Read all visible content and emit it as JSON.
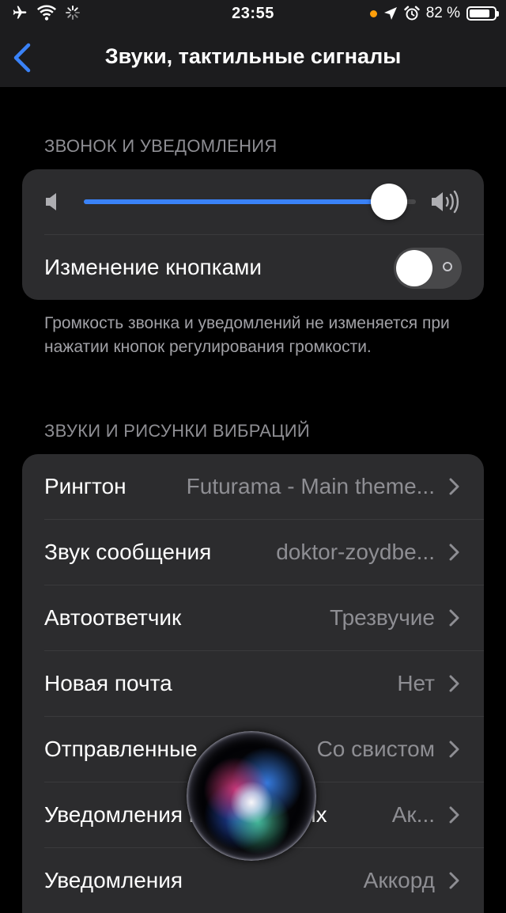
{
  "status_bar": {
    "time": "23:55",
    "battery_percent": "82 %",
    "battery_level": 0.82,
    "left_icons": [
      "airplane-icon",
      "wifi-icon",
      "activity-spinner-icon"
    ],
    "right_icons": [
      "privacy-dot-icon",
      "location-arrow-icon",
      "alarm-icon",
      "battery-icon"
    ]
  },
  "nav": {
    "title": "Звуки, тактильные сигналы",
    "back_icon": "chevron-left-icon"
  },
  "colors": {
    "accent": "#3a82f7",
    "background": "#000000",
    "group_background": "#2c2c2e",
    "secondary_text": "#8e8e93",
    "privacy_dot": "#ff9f0a"
  },
  "ringer_section": {
    "header": "ЗВОНОК И УВЕДОМЛЕНИЯ",
    "volume_level": 0.92,
    "change_with_buttons_label": "Изменение кнопками",
    "change_with_buttons_on": false,
    "footer": "Громкость звонка и уведомлений не изменяется при нажатии кнопок регулирования громкости."
  },
  "sounds_section": {
    "header": "ЗВУКИ И РИСУНКИ ВИБРАЦИЙ",
    "rows": [
      {
        "label": "Рингтон",
        "value": "Futurama - Main theme..."
      },
      {
        "label": "Звук сообщения",
        "value": "doktor-zoydbe..."
      },
      {
        "label": "Автоответчик",
        "value": "Трезвучие"
      },
      {
        "label": "Новая почта",
        "value": "Нет"
      },
      {
        "label": "Отправленные",
        "value": "Со свистом"
      },
      {
        "label": "Уведомления в календарях",
        "value": "Ак..."
      },
      {
        "label": "Уведомления",
        "value": "Аккорд"
      }
    ]
  }
}
